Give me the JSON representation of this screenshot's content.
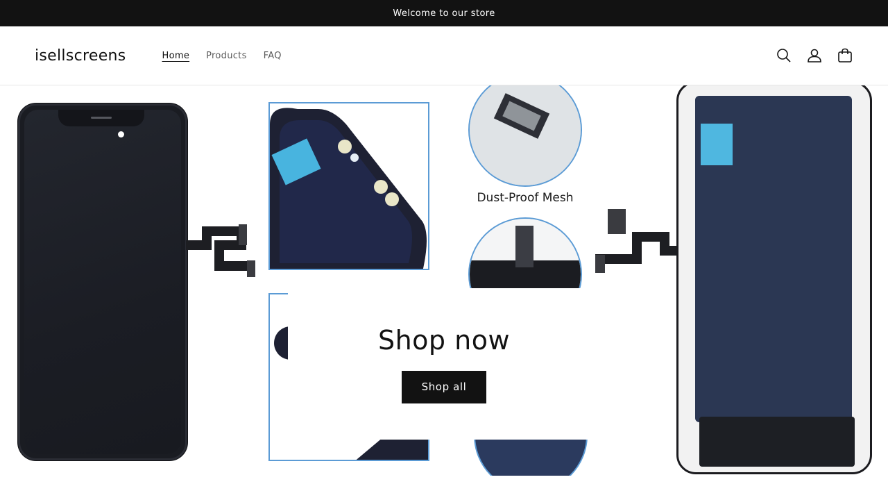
{
  "announcement": {
    "text": "Welcome to our store"
  },
  "header": {
    "logo": "isellscreens",
    "nav": [
      {
        "label": "Home",
        "active": true
      },
      {
        "label": "Products",
        "active": false
      },
      {
        "label": "FAQ",
        "active": false
      }
    ],
    "icons": [
      "search-icon",
      "account-icon",
      "cart-icon"
    ]
  },
  "hero": {
    "image_label": "Dust-Proof Mesh",
    "heading": "Shop now",
    "button_label": "Shop all"
  },
  "colors": {
    "announcement_bg": "#121212",
    "button_bg": "#121212",
    "accent_border": "#5b9bd5"
  }
}
